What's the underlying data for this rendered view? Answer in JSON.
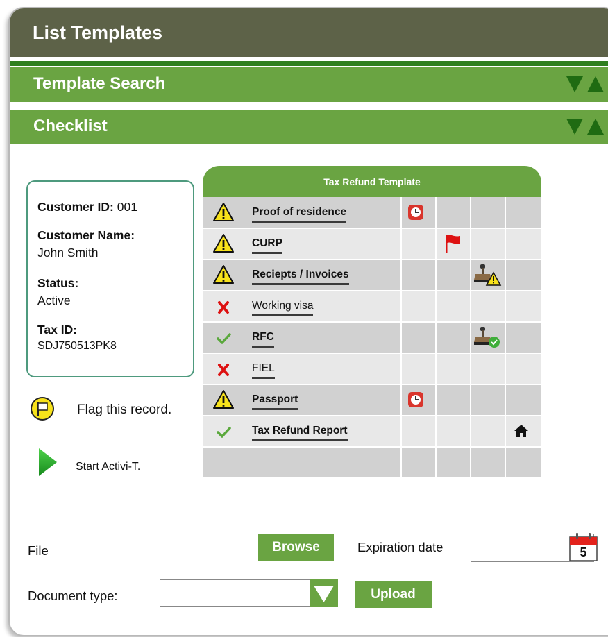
{
  "window": {
    "title": "List Templates"
  },
  "sections": [
    {
      "label": "Template Search"
    },
    {
      "label": "Checklist"
    }
  ],
  "customer": {
    "id_label": "Customer ID:",
    "id_value": "001",
    "name_label": "Customer Name:",
    "name_value": "John Smith",
    "status_label": "Status:",
    "status_value": "Active",
    "tax_label": "Tax ID:",
    "tax_value": "SDJ750513PK8"
  },
  "actions": {
    "flag_label": "Flag this record.",
    "start_label": "Start Activi-T."
  },
  "template": {
    "title": "Tax Refund Template",
    "rows": [
      {
        "status": "warning-icon",
        "label": "Proof of residence",
        "bold": true,
        "col1": "clock-icon",
        "col2": "",
        "col3": "",
        "col4": ""
      },
      {
        "status": "warning-icon",
        "label": "CURP",
        "bold": true,
        "col1": "",
        "col2": "flag-icon",
        "col3": "",
        "col4": ""
      },
      {
        "status": "warning-icon",
        "label": "Reciepts / Invoices",
        "bold": true,
        "col1": "",
        "col2": "",
        "col3": "stamp-warning-icon",
        "col4": ""
      },
      {
        "status": "x-icon",
        "label": "Working visa",
        "bold": false,
        "col1": "",
        "col2": "",
        "col3": "",
        "col4": ""
      },
      {
        "status": "check-icon",
        "label": "RFC",
        "bold": true,
        "col1": "",
        "col2": "",
        "col3": "stamp-check-icon",
        "col4": ""
      },
      {
        "status": "x-icon",
        "label": "FIEL",
        "bold": false,
        "col1": "",
        "col2": "",
        "col3": "",
        "col4": ""
      },
      {
        "status": "warning-icon",
        "label": "Passport",
        "bold": true,
        "col1": "clock-icon",
        "col2": "",
        "col3": "",
        "col4": ""
      },
      {
        "status": "check-icon",
        "label": "Tax Refund Report",
        "bold": true,
        "col1": "",
        "col2": "",
        "col3": "",
        "col4": "home-icon"
      }
    ]
  },
  "upload": {
    "file_label": "File",
    "file_value": "",
    "browse_label": "Browse",
    "expiration_label": "Expiration date",
    "expiration_value": "",
    "calendar_day": "5",
    "doctype_label": "Document type:",
    "doctype_value": "",
    "upload_label": "Upload"
  },
  "colors": {
    "title_bar": "#5d6248",
    "section_green": "#6aa442",
    "accent_dark_green": "#2f7f1f",
    "warning_yellow": "#f7e21b",
    "error_red": "#dd1111",
    "ok_green": "#5aa83c"
  }
}
